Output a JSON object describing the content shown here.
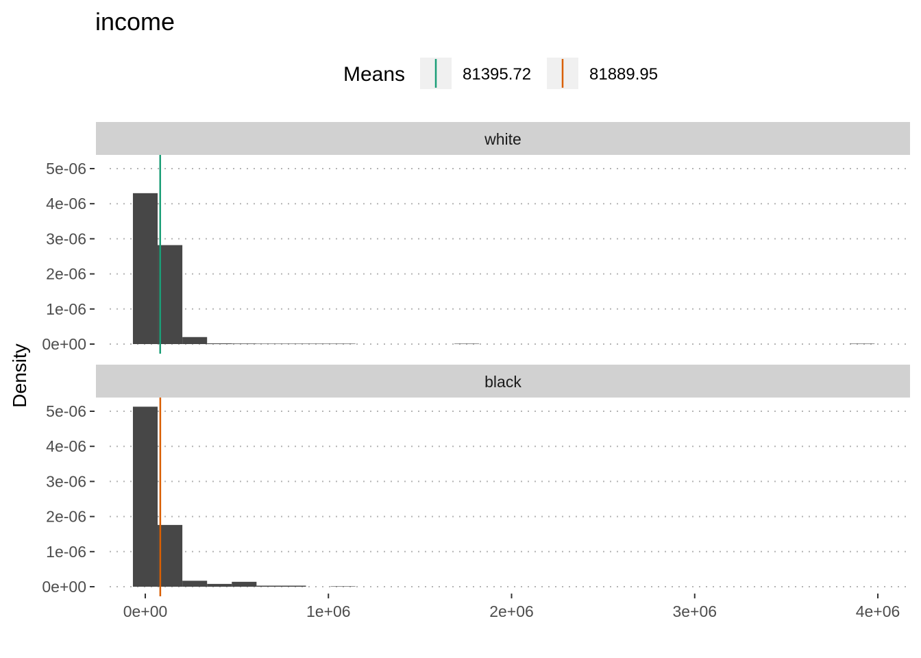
{
  "chart_data": {
    "type": "bar",
    "title": "income",
    "xlabel": "",
    "ylabel": "Density",
    "xlim": [
      -250000,
      4150000
    ],
    "ylim": [
      -2.5e-07,
      5.4e-06
    ],
    "x_ticks": [
      0,
      1000000,
      2000000,
      3000000,
      4000000
    ],
    "x_tick_labels": [
      "0e+00",
      "1e+06",
      "2e+06",
      "3e+06",
      "4e+06"
    ],
    "y_ticks": [
      0,
      1e-06,
      2e-06,
      3e-06,
      4e-06,
      5e-06
    ],
    "y_tick_labels": [
      "0e+00",
      "1e-06",
      "2e-06",
      "3e-06",
      "4e-06",
      "5e-06"
    ],
    "grid": "horizontal-dotted",
    "legend": {
      "title": "Means",
      "placement": "top",
      "entries": [
        {
          "label": "81395.72",
          "color": "#1b9e77"
        },
        {
          "label": "81889.95",
          "color": "#d95f02"
        }
      ]
    },
    "bin_width": 135000,
    "bar_color": "#474747",
    "panels": [
      {
        "strip": "white",
        "mean": 81395.72,
        "mean_color": "#1b9e77",
        "bins": [
          {
            "start": -67500,
            "end": 67500,
            "density": 4.3e-06
          },
          {
            "start": 67500,
            "end": 202500,
            "density": 2.82e-06
          },
          {
            "start": 202500,
            "end": 337500,
            "density": 2e-07
          },
          {
            "start": 337500,
            "end": 472500,
            "density": 2e-08
          },
          {
            "start": 472500,
            "end": 607500,
            "density": 1.5e-08
          },
          {
            "start": 607500,
            "end": 742500,
            "density": 1e-08
          },
          {
            "start": 742500,
            "end": 877500,
            "density": 8e-09
          },
          {
            "start": 877500,
            "end": 1012500,
            "density": 6e-09
          },
          {
            "start": 1012500,
            "end": 1147500,
            "density": 5e-09
          },
          {
            "start": 1687500,
            "end": 1822500,
            "density": 3e-09
          },
          {
            "start": 3847500,
            "end": 3982500,
            "density": 3e-09
          }
        ]
      },
      {
        "strip": "black",
        "mean": 81889.95,
        "mean_color": "#d95f02",
        "bins": [
          {
            "start": -67500,
            "end": 67500,
            "density": 5.13e-06
          },
          {
            "start": 67500,
            "end": 202500,
            "density": 1.76e-06
          },
          {
            "start": 202500,
            "end": 337500,
            "density": 1.7e-07
          },
          {
            "start": 337500,
            "end": 472500,
            "density": 8e-08
          },
          {
            "start": 472500,
            "end": 607500,
            "density": 1.4e-07
          },
          {
            "start": 607500,
            "end": 742500,
            "density": 3e-08
          },
          {
            "start": 742500,
            "end": 877500,
            "density": 3e-08
          },
          {
            "start": 1012500,
            "end": 1147500,
            "density": 1e-08
          }
        ]
      }
    ]
  }
}
